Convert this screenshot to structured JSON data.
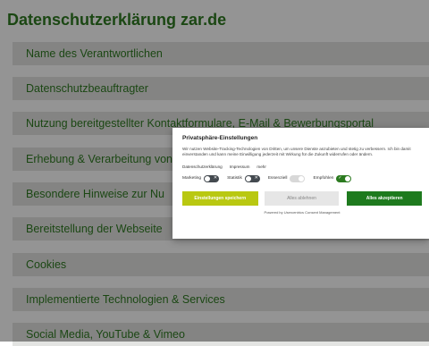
{
  "page": {
    "title": "Datenschutzerklärung zar.de",
    "sections": [
      "Name des Verantwortlichen",
      "Datenschutzbeauftragter",
      "Nutzung bereitgestellter Kontaktformulare, E-Mail & Bewerbungsportal",
      "Erhebung & Verarbeitung von",
      "Besondere Hinweise zur Nu",
      "Bereitstellung der Webseite",
      "Cookies",
      "Implementierte Technologien & Services",
      "Social Media, YouTube & Vimeo"
    ]
  },
  "colors": {
    "brand_green": "#2f7a22",
    "save_button": "#b9c811",
    "accept_button": "#1e7a1e"
  },
  "consent": {
    "title": "Privatsphäre-Einstellungen",
    "description": "Wir nutzen Website-Tracking-Technologien von Dritten, um unsere Dienste anzubieten und stetig zu verbessern. Ich bin damit einverstanden und kann meine Einwilligung jederzeit mit Wirkung für die Zukunft widerrufen oder ändern.",
    "links": [
      "Datenschutzerklärung",
      "Impressum",
      "mehr"
    ],
    "toggles": [
      {
        "label": "Marketing",
        "state": "off"
      },
      {
        "label": "Statistik",
        "state": "off"
      },
      {
        "label": "Essenziell",
        "state": "disabled"
      },
      {
        "label": "Empfohlen",
        "state": "on"
      }
    ],
    "buttons": {
      "save": "Einstellungen speichern",
      "deny": "Alles ablehnen",
      "accept": "Alles akzeptieren"
    },
    "powered": "Powered by Usercentrics Consent Management"
  }
}
